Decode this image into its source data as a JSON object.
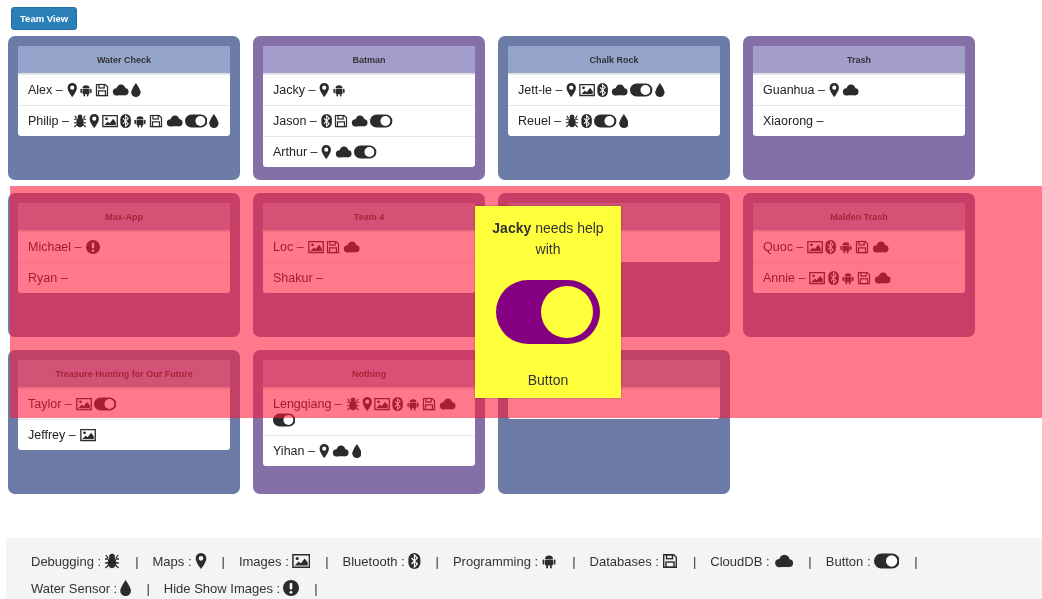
{
  "toolbar": {
    "button": "Team View"
  },
  "teams": [
    {
      "name": "Water Check",
      "color": "#6b7ba6",
      "members": [
        {
          "label": "Alex –",
          "skills": [
            {
              "kind": "map"
            },
            {
              "kind": "android"
            },
            {
              "kind": "database"
            },
            {
              "kind": "cloud"
            },
            {
              "kind": "water"
            }
          ]
        },
        {
          "label": "Philip –",
          "skills": [
            {
              "kind": "bug"
            },
            {
              "kind": "map"
            },
            {
              "kind": "image"
            },
            {
              "kind": "bluetooth"
            },
            {
              "kind": "android"
            },
            {
              "kind": "database"
            },
            {
              "kind": "cloud"
            },
            {
              "kind": "button"
            },
            {
              "kind": "water"
            }
          ]
        }
      ]
    },
    {
      "name": "Batman",
      "color": "#8470a6",
      "members": [
        {
          "label": "Jacky –",
          "skills": [
            {
              "kind": "map"
            },
            {
              "kind": "android"
            }
          ]
        },
        {
          "label": "Jason –",
          "skills": [
            {
              "kind": "bluetooth"
            },
            {
              "kind": "database"
            },
            {
              "kind": "cloud"
            },
            {
              "kind": "button"
            }
          ]
        },
        {
          "label": "Arthur –",
          "skills": [
            {
              "kind": "map"
            },
            {
              "kind": "cloud"
            },
            {
              "kind": "button"
            }
          ]
        }
      ]
    },
    {
      "name": "Chalk Rock",
      "color": "#6b7ba6",
      "members": [
        {
          "label": "Jett-le –",
          "skills": [
            {
              "kind": "map"
            },
            {
              "kind": "image"
            },
            {
              "kind": "bluetooth"
            },
            {
              "kind": "cloud"
            },
            {
              "kind": "button"
            },
            {
              "kind": "water"
            }
          ]
        },
        {
          "label": "Reuel –",
          "skills": [
            {
              "kind": "bug"
            },
            {
              "kind": "bluetooth"
            },
            {
              "kind": "button"
            },
            {
              "kind": "water"
            }
          ]
        }
      ]
    },
    {
      "name": "Trash",
      "color": "#8470a6",
      "members": [
        {
          "label": "Guanhua –",
          "skills": [
            {
              "kind": "map"
            },
            {
              "kind": "cloud"
            }
          ]
        },
        {
          "label": "Xiaorong –"
        }
      ]
    },
    {
      "name": "Max-App",
      "members": [
        {
          "label": "Michael –",
          "skills": [
            {
              "kind": "alert"
            }
          ]
        },
        {
          "label": "Ryan –"
        }
      ]
    },
    {
      "name": "Team 4",
      "members": [
        {
          "label": "Loc –",
          "skills": [
            {
              "kind": "image"
            },
            {
              "kind": "database"
            },
            {
              "kind": "cloud"
            }
          ]
        },
        {
          "label": "Shakur –"
        }
      ]
    },
    {
      "kind": "covered"
    },
    {
      "name": "Malden Trash",
      "members": [
        {
          "label": "Quoc –",
          "skills": [
            {
              "kind": "image"
            },
            {
              "kind": "bluetooth"
            },
            {
              "kind": "android"
            },
            {
              "kind": "database"
            },
            {
              "kind": "cloud"
            }
          ]
        },
        {
          "label": "Annie –",
          "skills": [
            {
              "kind": "image"
            },
            {
              "kind": "bluetooth"
            },
            {
              "kind": "android"
            },
            {
              "kind": "database"
            },
            {
              "kind": "cloud"
            }
          ]
        }
      ]
    },
    {
      "name": "Treasure Hunting for Our Future",
      "color": "#6b7ba6",
      "members": [
        {
          "label": "Taylor –",
          "skills": [
            {
              "kind": "image"
            },
            {
              "kind": "button"
            }
          ]
        },
        {
          "label": "Jeffrey –",
          "skills": [
            {
              "kind": "image"
            }
          ]
        }
      ]
    },
    {
      "name": "Nothing",
      "color": "#8470a6",
      "members": [
        {
          "label": "Lengqiang –",
          "skills": [
            {
              "kind": "bug"
            },
            {
              "kind": "map"
            },
            {
              "kind": "image"
            },
            {
              "kind": "bluetooth"
            },
            {
              "kind": "android"
            },
            {
              "kind": "database"
            },
            {
              "kind": "cloud"
            },
            {
              "kind": "button"
            }
          ]
        },
        {
          "label": "Yihan –",
          "skills": [
            {
              "kind": "map"
            },
            {
              "kind": "cloud"
            },
            {
              "kind": "water"
            }
          ]
        }
      ]
    },
    {
      "kind": "covered",
      "color": "#6b7ba6"
    }
  ],
  "help_popup": {
    "message": "**Jacky** needs help with",
    "kind": "button",
    "skill_label": "Button"
  },
  "legend": {
    "separator": "|",
    "items": [
      {
        "label": "Debugging :",
        "kind": "bug"
      },
      {
        "label": "Maps :",
        "kind": "map"
      },
      {
        "label": "Images :",
        "kind": "image"
      },
      {
        "label": "Bluetooth :",
        "kind": "bluetooth"
      },
      {
        "label": "Programming :",
        "kind": "android"
      },
      {
        "label": "Databases :",
        "kind": "database"
      },
      {
        "label": "CloudDB :",
        "kind": "cloud"
      },
      {
        "label": "Button :",
        "kind": "button"
      },
      {
        "label": "Water Sensor :",
        "kind": "water"
      },
      {
        "label": "Hide Show Images :",
        "kind": "alert"
      }
    ]
  }
}
